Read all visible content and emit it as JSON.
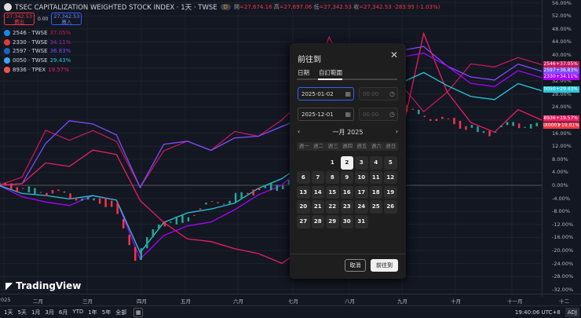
{
  "header": {
    "title": "TSEC CAPITALIZATION WEIGHTED STOCK INDEX · 1天 · TWSE",
    "badge": "D",
    "ohlc": [
      {
        "k": "開",
        "v": "=27,674.16"
      },
      {
        "k": "高",
        "v": "=27,697.06"
      },
      {
        "k": "低",
        "v": "=27,342.53"
      },
      {
        "k": "收",
        "v": "=27,342.53  -283.95 (-1.03%)"
      }
    ]
  },
  "trade": {
    "sell_price": "27,342.53",
    "sell_label": "賣出",
    "spread": "0.00",
    "buy_price": "27,342.53",
    "buy_label": "買入"
  },
  "legend": [
    {
      "name": "2546 · TWSE",
      "pct": "37.05%",
      "color": "#c2185b",
      "icon": "#1e88e5"
    },
    {
      "name": "2330 · TWSE",
      "pct": "34.11%",
      "color": "#9c27b0",
      "icon": "#e53935"
    },
    {
      "name": "2597 · TWSE",
      "pct": "36.83%",
      "color": "#7c4dff",
      "icon": "#1565c0"
    },
    {
      "name": "0050 · TWSE",
      "pct": "29.43%",
      "color": "#26c6da",
      "icon": "#42a5f5"
    },
    {
      "name": "8936 · TPEX",
      "pct": "19.57%",
      "color": "#e91e63",
      "icon": "#ef5350"
    }
  ],
  "price_tags": [
    {
      "sym": "2546",
      "val": "+37.05%",
      "color": "#c2185b",
      "pct": 37.05
    },
    {
      "sym": "2597",
      "val": "+36.83%",
      "color": "#7c4dff",
      "pct": 35.2
    },
    {
      "sym": "2330",
      "val": "+34.11%",
      "color": "#aa00ff",
      "pct": 33.2
    },
    {
      "sym": "0050",
      "val": "+29.43%",
      "color": "#26c6da",
      "pct": 29.43
    },
    {
      "sym": "8936",
      "val": "+19.57%",
      "color": "#e91e63",
      "pct": 20.6
    },
    {
      "sym": "IX0001",
      "val": "+19.01%",
      "color": "#f23645",
      "pct": 18.3
    }
  ],
  "chart_data": {
    "type": "line",
    "ylim": [
      -32,
      56
    ],
    "yticks": [
      "56.00%",
      "52.00%",
      "48.00%",
      "44.00%",
      "40.00%",
      "36.00%",
      "32.00%",
      "28.00%",
      "24.00%",
      "20.00%",
      "16.00%",
      "12.00%",
      "8.00%",
      "4.00%",
      "0.00%",
      "-4.00%",
      "-8.00%",
      "-12.00%",
      "-16.00%",
      "-20.00%",
      "-24.00%",
      "-28.00%",
      "-32.00%"
    ],
    "xticks": [
      "2025",
      "二月",
      "三月",
      "四月",
      "五月",
      "六月",
      "七月",
      "八月",
      "九月",
      "十月",
      "十一月",
      "十二"
    ],
    "series": [
      {
        "name": "2546",
        "color": "#c2185b",
        "values": [
          0,
          4,
          18,
          14,
          16,
          12,
          -2,
          10,
          14,
          12,
          18,
          16,
          20,
          26,
          44,
          30,
          28,
          32,
          24,
          30,
          38,
          36,
          38,
          37
        ]
      },
      {
        "name": "2597",
        "color": "#7c4dff",
        "values": [
          0,
          2,
          14,
          20,
          18,
          14,
          -2,
          12,
          14,
          12,
          16,
          16,
          18,
          20,
          24,
          28,
          40,
          42,
          44,
          38,
          34,
          32,
          36,
          35
        ]
      },
      {
        "name": "8936",
        "color": "#e91e63",
        "values": [
          0,
          2,
          8,
          6,
          10,
          8,
          -6,
          -12,
          -16,
          -16,
          -18,
          -20,
          -24,
          -20,
          -16,
          -12,
          -2,
          14,
          48,
          30,
          20,
          16,
          22,
          20
        ]
      },
      {
        "name": "2330",
        "color": "#aa00ff",
        "values": [
          0,
          -2,
          -4,
          -6,
          -4,
          -6,
          -24,
          -16,
          -12,
          -10,
          -6,
          -2,
          0,
          6,
          10,
          18,
          36,
          40,
          42,
          38,
          32,
          30,
          34,
          33
        ]
      },
      {
        "name": "0050",
        "color": "#26c6da",
        "values": [
          0,
          -1,
          -2,
          -4,
          -4,
          -6,
          -22,
          -12,
          -8,
          -6,
          -4,
          0,
          2,
          6,
          10,
          14,
          22,
          32,
          36,
          32,
          28,
          26,
          30,
          29
        ]
      },
      {
        "name": "TWSE",
        "color": "#26a69a",
        "type": "candle",
        "values": [
          0,
          -1,
          -2,
          -3,
          -4,
          -6,
          -22,
          -12,
          -10,
          -6,
          -4,
          -2,
          0,
          4,
          8,
          14,
          20,
          24,
          22,
          20,
          18,
          16,
          19,
          18
        ]
      }
    ]
  },
  "branding": "TradingView",
  "bottom": {
    "ranges": [
      "1天",
      "5天",
      "1月",
      "3月",
      "6月",
      "YTD",
      "1年",
      "5年",
      "全部"
    ],
    "time": "19:40:06 UTC+8",
    "adj": "ADJ"
  },
  "dialog": {
    "title": "前往到",
    "tabs": [
      "日期",
      "自訂範圍"
    ],
    "start_date": "2025-01-02",
    "start_time": "00:00",
    "end_date": "2025-12-01",
    "end_time": "00:00",
    "month": "一月 2025",
    "weekdays": [
      "週一",
      "週二",
      "週三",
      "週四",
      "週五",
      "週六",
      "週日"
    ],
    "days": [
      "1",
      "2",
      "3",
      "4",
      "5",
      "6",
      "7",
      "8",
      "9",
      "10",
      "11",
      "12",
      "13",
      "14",
      "15",
      "16",
      "17",
      "18",
      "19",
      "20",
      "21",
      "22",
      "23",
      "24",
      "25",
      "26",
      "27",
      "28",
      "29",
      "30",
      "31"
    ],
    "selected_day": "2",
    "cancel": "取消",
    "go": "前往到"
  }
}
